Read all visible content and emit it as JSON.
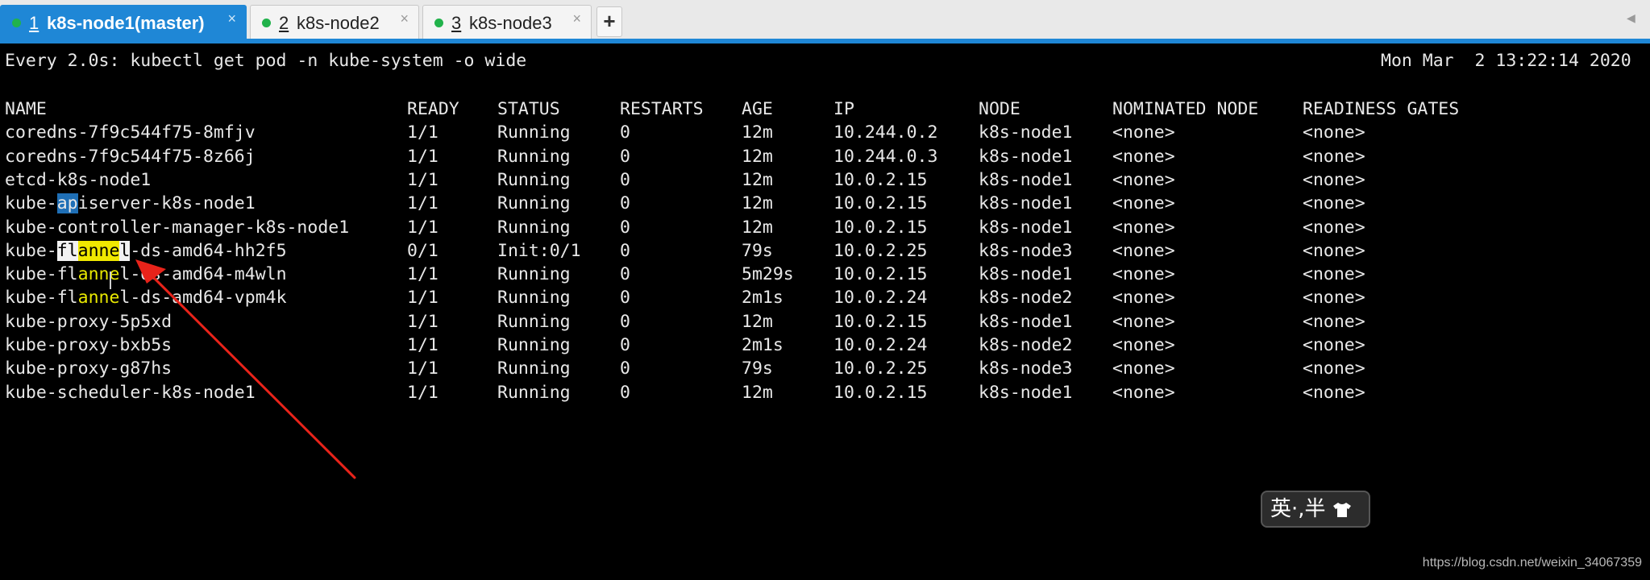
{
  "tabs": [
    {
      "num": "1",
      "label": "k8s-node1(master)",
      "active": true
    },
    {
      "num": "2",
      "label": "k8s-node2",
      "active": false
    },
    {
      "num": "3",
      "label": "k8s-node3",
      "active": false
    }
  ],
  "tab_close_glyph": "×",
  "add_tab_label": "+",
  "scroll_left_glyph": "◀",
  "terminal": {
    "watch_command": "Every 2.0s: kubectl get pod -n kube-system -o wide",
    "timestamp": "Mon Mar  2 13:22:14 2020",
    "columns": [
      "NAME",
      "READY",
      "STATUS",
      "RESTARTS",
      "AGE",
      "IP",
      "NODE",
      "NOMINATED NODE",
      "READINESS GATES"
    ],
    "rows": [
      [
        "coredns-7f9c544f75-8mfjv",
        "1/1",
        "Running",
        "0",
        "12m",
        "10.244.0.2",
        "k8s-node1",
        "<none>",
        "<none>"
      ],
      [
        "coredns-7f9c544f75-8z66j",
        "1/1",
        "Running",
        "0",
        "12m",
        "10.244.0.3",
        "k8s-node1",
        "<none>",
        "<none>"
      ],
      [
        "etcd-k8s-node1",
        "1/1",
        "Running",
        "0",
        "12m",
        "10.0.2.15",
        "k8s-node1",
        "<none>",
        "<none>"
      ],
      [
        "kube-apiserver-k8s-node1",
        "1/1",
        "Running",
        "0",
        "12m",
        "10.0.2.15",
        "k8s-node1",
        "<none>",
        "<none>"
      ],
      [
        "kube-controller-manager-k8s-node1",
        "1/1",
        "Running",
        "0",
        "12m",
        "10.0.2.15",
        "k8s-node1",
        "<none>",
        "<none>"
      ],
      [
        "kube-flannel-ds-amd64-hh2f5",
        "0/1",
        "Init:0/1",
        "0",
        "79s",
        "10.0.2.25",
        "k8s-node3",
        "<none>",
        "<none>"
      ],
      [
        "kube-flannel-ds-amd64-m4wln",
        "1/1",
        "Running",
        "0",
        "5m29s",
        "10.0.2.15",
        "k8s-node1",
        "<none>",
        "<none>"
      ],
      [
        "kube-flannel-ds-amd64-vpm4k",
        "1/1",
        "Running",
        "0",
        "2m1s",
        "10.0.2.24",
        "k8s-node2",
        "<none>",
        "<none>"
      ],
      [
        "kube-proxy-5p5xd",
        "1/1",
        "Running",
        "0",
        "12m",
        "10.0.2.15",
        "k8s-node1",
        "<none>",
        "<none>"
      ],
      [
        "kube-proxy-bxb5s",
        "1/1",
        "Running",
        "0",
        "2m1s",
        "10.0.2.24",
        "k8s-node2",
        "<none>",
        "<none>"
      ],
      [
        "kube-proxy-g87hs",
        "1/1",
        "Running",
        "0",
        "79s",
        "10.0.2.25",
        "k8s-node3",
        "<none>",
        "<none>"
      ],
      [
        "kube-scheduler-k8s-node1",
        "1/1",
        "Running",
        "0",
        "12m",
        "10.0.2.15",
        "k8s-node1",
        "<none>",
        "<none>"
      ]
    ]
  },
  "ime_indicator": "英·,半",
  "ime_icon": "shirt-icon",
  "watermark": "https://blog.csdn.net/weixin_34067359",
  "colors": {
    "tab_active": "#1f87d6",
    "status_dot": "#21b24b",
    "annotation_arrow": "#e8231a",
    "highlight_yellow": "#f0e800",
    "selection_blue": "#1f6fb6"
  }
}
